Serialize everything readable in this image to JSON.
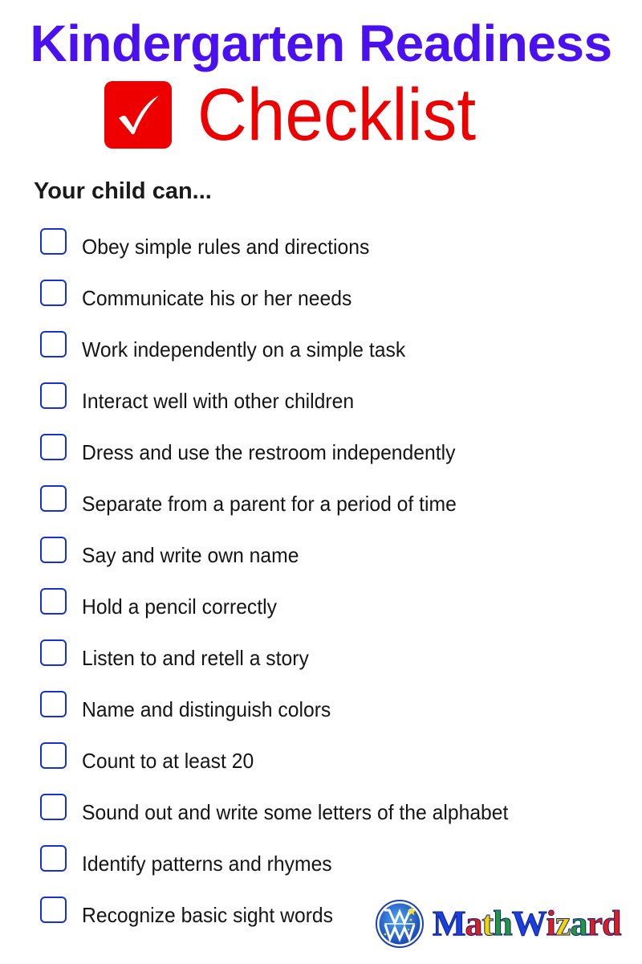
{
  "header": {
    "title": "Kindergarten Readiness",
    "subtitle": "Checklist",
    "title_color": "#4A10F0",
    "subtitle_color": "#EE0000",
    "badge_icon": "checkmark-icon"
  },
  "lead": "Your child can...",
  "checklist": {
    "checkbox_color": "#1530D8",
    "items": [
      {
        "label": "Obey simple rules and directions",
        "checked": false
      },
      {
        "label": "Communicate his or her needs",
        "checked": false
      },
      {
        "label": "Work independently on a simple task",
        "checked": false
      },
      {
        "label": "Interact well with other children",
        "checked": false
      },
      {
        "label": "Dress and use the restroom independently",
        "checked": false
      },
      {
        "label": "Separate from a parent for a period of time",
        "checked": false
      },
      {
        "label": "Say and write own name",
        "checked": false
      },
      {
        "label": "Hold a pencil correctly",
        "checked": false
      },
      {
        "label": "Listen to and retell a story",
        "checked": false
      },
      {
        "label": "Name and distinguish colors",
        "checked": false
      },
      {
        "label": "Count to at least 20",
        "checked": false
      },
      {
        "label": "Sound out and write some letters of the alphabet",
        "checked": false
      },
      {
        "label": "Identify patterns and rhymes",
        "checked": false
      },
      {
        "label": "Recognize basic sight words",
        "checked": false
      }
    ]
  },
  "logo": {
    "emblem_icon": "mw-emblem-icon",
    "letters": [
      {
        "char": "M",
        "color": "#1A3FE0"
      },
      {
        "char": "a",
        "color": "#E41B1B"
      },
      {
        "char": "t",
        "color": "#F2D400"
      },
      {
        "char": "h",
        "color": "#1E9A3A"
      },
      {
        "char": "W",
        "color": "#1A3FE0"
      },
      {
        "char": "i",
        "color": "#E41B1B"
      },
      {
        "char": "z",
        "color": "#F2D400"
      },
      {
        "char": "a",
        "color": "#1E9A3A"
      },
      {
        "char": "r",
        "color": "#E41B1B"
      },
      {
        "char": "d",
        "color": "#E41B1B"
      }
    ]
  }
}
